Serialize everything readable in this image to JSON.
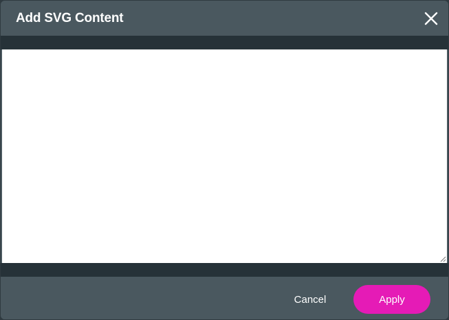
{
  "dialog": {
    "title": "Add SVG Content",
    "close_icon": "close-icon",
    "editor": {
      "value": "",
      "placeholder": ""
    },
    "footer": {
      "cancel_label": "Cancel",
      "apply_label": "Apply"
    }
  },
  "colors": {
    "panel": "#4a585f",
    "band": "#263238",
    "editor_bg": "#ffffff",
    "accent": "#e51bb6",
    "text": "#ffffff"
  }
}
